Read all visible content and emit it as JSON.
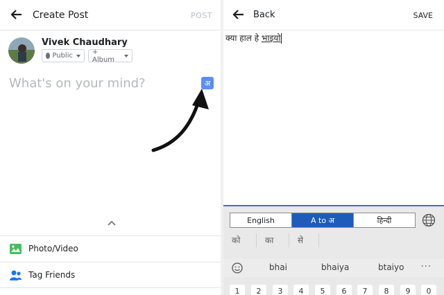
{
  "create_post": {
    "title": "Create Post",
    "post_label": "POST",
    "user_name": "Vivek Chaudhary",
    "privacy_label": "Public",
    "album_label": "+ Album",
    "placeholder": "What's on your mind?",
    "hindi_toggle_glyph": "अ",
    "actions": [
      {
        "label": "Photo/Video",
        "icon": "photo-icon"
      },
      {
        "label": "Tag Friends",
        "icon": "tag-friends-icon"
      }
    ]
  },
  "editor": {
    "back_label": "Back",
    "save_label": "SAVE",
    "text_plain": "क्या हाल हे ",
    "text_composing": "भाइयो"
  },
  "keyboard": {
    "tabs": [
      "English",
      "A to अ",
      "हिन्दी"
    ],
    "active_tab": "A to अ",
    "suggestions": [
      "को",
      "का",
      "से"
    ],
    "predictions": [
      "bhai",
      "bhaiya",
      "btaiyo"
    ],
    "more_label": "···",
    "key_hints": [
      "1",
      "2",
      "3",
      "4",
      "5",
      "6",
      "7",
      "8",
      "9",
      "0"
    ]
  },
  "colors": {
    "accent_blue": "#1f5bb9",
    "toggle_blue": "#5b8ff0",
    "photo_green": "#45bd62",
    "tag_blue": "#1877f2"
  }
}
